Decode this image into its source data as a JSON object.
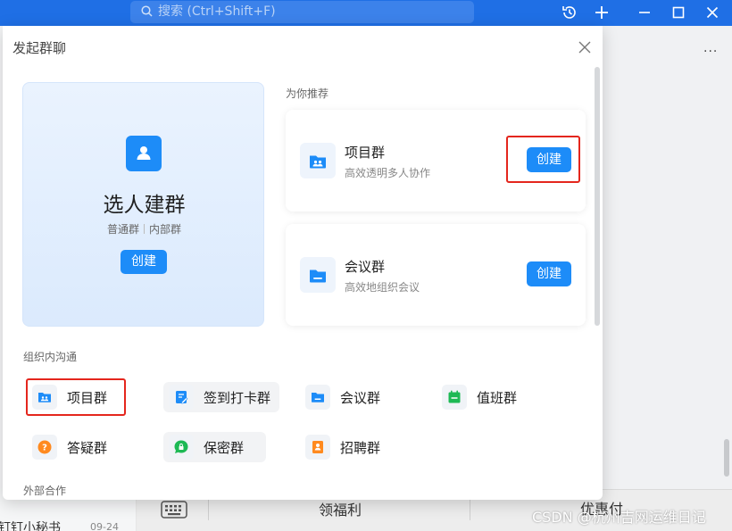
{
  "app": {
    "search_placeholder": "搜索 (Ctrl+Shift+F)",
    "more_label": "...",
    "bottom_bar": {
      "welfare_label": "领福利",
      "coupon_label": "优惠付"
    },
    "chat_preview": {
      "name": "钉钉小秘书",
      "date": "09-24"
    },
    "watermark": "CSDN @杭州吉网运维日记"
  },
  "dialog": {
    "title": "发起群聊",
    "main_card": {
      "title": "选人建群",
      "subtitle_a": "普通群",
      "subtitle_b": "内部群",
      "create_label": "创建"
    },
    "recommend": {
      "section_title": "为你推荐",
      "cards": [
        {
          "name": "项目群",
          "desc": "高效透明多人协作",
          "button": "创建",
          "icon": "project-group-icon"
        },
        {
          "name": "会议群",
          "desc": "高效地组织会议",
          "button": "创建",
          "icon": "meeting-group-icon"
        }
      ]
    },
    "internal": {
      "section_title": "组织内沟通",
      "items": [
        {
          "label": "项目群",
          "icon": "project-group-icon"
        },
        {
          "label": "签到打卡群",
          "icon": "checkin-group-icon"
        },
        {
          "label": "会议群",
          "icon": "meeting-group-icon"
        },
        {
          "label": "值班群",
          "icon": "duty-group-icon"
        },
        {
          "label": "答疑群",
          "icon": "qa-group-icon"
        },
        {
          "label": "保密群",
          "icon": "secret-group-icon"
        },
        {
          "label": "招聘群",
          "icon": "recruit-group-icon"
        }
      ]
    },
    "external": {
      "section_title": "外部合作"
    }
  },
  "colors": {
    "accent": "#1d8cf8",
    "titlebar": "#1f6fe5",
    "highlight": "#e4261d",
    "green": "#1db954",
    "orange": "#ff8a1f"
  }
}
